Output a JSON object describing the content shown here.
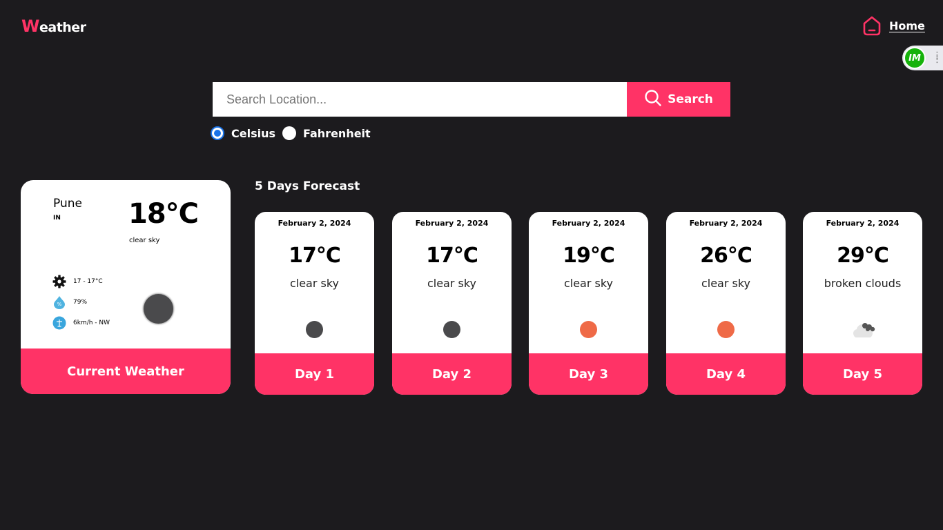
{
  "header": {
    "logo_first": "W",
    "logo_rest": "eather",
    "home_label": "Home",
    "home_icon": "home-icon",
    "extension_badge": "IM"
  },
  "search": {
    "placeholder": "Search Location...",
    "value": "",
    "button_label": "Search",
    "button_icon": "search-icon"
  },
  "units": {
    "options": [
      {
        "label": "Celsius",
        "checked": true
      },
      {
        "label": "Fahrenheit",
        "checked": false
      }
    ]
  },
  "current": {
    "city": "Pune",
    "country": "IN",
    "temp": "18°C",
    "description": "clear sky",
    "range": "17 - 17°C",
    "humidity": "79%",
    "wind": "6km/h - NW",
    "footer": "Current Weather"
  },
  "forecast": {
    "title": "5 Days Forecast",
    "days": [
      {
        "date": "February 2, 2024",
        "temp": "17°C",
        "description": "clear sky",
        "label": "Day 1",
        "icon": "moon-icon",
        "icon_color": "#4a4a4c"
      },
      {
        "date": "February 2, 2024",
        "temp": "17°C",
        "description": "clear sky",
        "label": "Day 2",
        "icon": "moon-icon",
        "icon_color": "#4a4a4c"
      },
      {
        "date": "February 2, 2024",
        "temp": "19°C",
        "description": "clear sky",
        "label": "Day 3",
        "icon": "sun-icon",
        "icon_color": "#ef6a47"
      },
      {
        "date": "February 2, 2024",
        "temp": "26°C",
        "description": "clear sky",
        "label": "Day 4",
        "icon": "sun-icon",
        "icon_color": "#ef6a47"
      },
      {
        "date": "February 2, 2024",
        "temp": "29°C",
        "description": "broken clouds",
        "label": "Day 5",
        "icon": "cloud-icon",
        "icon_color": "#d9d9d9"
      }
    ]
  },
  "colors": {
    "accent": "#ff3366",
    "background": "#1c1b1e",
    "radio": "#1a73e8"
  }
}
